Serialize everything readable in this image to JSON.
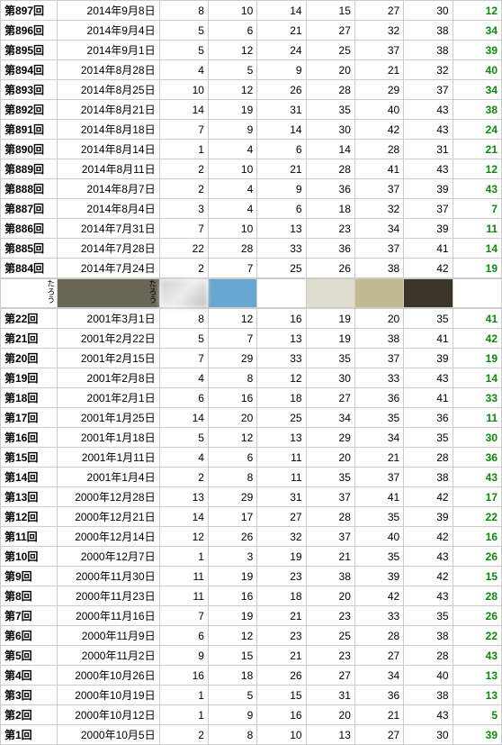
{
  "upper_rows": [
    {
      "label": "第897回",
      "date": "2014年9月8日",
      "n": [
        8,
        10,
        14,
        15,
        27,
        30
      ],
      "g": 12
    },
    {
      "label": "第896回",
      "date": "2014年9月4日",
      "n": [
        5,
        6,
        21,
        27,
        32,
        38
      ],
      "g": 34
    },
    {
      "label": "第895回",
      "date": "2014年9月1日",
      "n": [
        5,
        12,
        24,
        25,
        37,
        38
      ],
      "g": 39
    },
    {
      "label": "第894回",
      "date": "2014年8月28日",
      "n": [
        4,
        5,
        9,
        20,
        21,
        32
      ],
      "g": 40
    },
    {
      "label": "第893回",
      "date": "2014年8月25日",
      "n": [
        10,
        12,
        26,
        28,
        29,
        37
      ],
      "g": 34
    },
    {
      "label": "第892回",
      "date": "2014年8月21日",
      "n": [
        14,
        19,
        31,
        35,
        40,
        43
      ],
      "g": 38
    },
    {
      "label": "第891回",
      "date": "2014年8月18日",
      "n": [
        7,
        9,
        14,
        30,
        42,
        43
      ],
      "g": 24
    },
    {
      "label": "第890回",
      "date": "2014年8月14日",
      "n": [
        1,
        4,
        6,
        14,
        28,
        31
      ],
      "g": 21
    },
    {
      "label": "第889回",
      "date": "2014年8月11日",
      "n": [
        2,
        10,
        21,
        28,
        41,
        43
      ],
      "g": 12
    },
    {
      "label": "第888回",
      "date": "2014年8月7日",
      "n": [
        2,
        4,
        9,
        36,
        37,
        39
      ],
      "g": 43
    },
    {
      "label": "第887回",
      "date": "2014年8月4日",
      "n": [
        3,
        4,
        6,
        18,
        32,
        37
      ],
      "g": 7
    },
    {
      "label": "第886回",
      "date": "2014年7月31日",
      "n": [
        7,
        10,
        13,
        23,
        34,
        39
      ],
      "g": 11
    },
    {
      "label": "第885回",
      "date": "2014年7月28日",
      "n": [
        22,
        28,
        33,
        36,
        37,
        41
      ],
      "g": 14
    },
    {
      "label": "第884回",
      "date": "2014年7月24日",
      "n": [
        2,
        7,
        25,
        26,
        38,
        42
      ],
      "g": 19
    }
  ],
  "swatches": [
    {
      "label": "たろう",
      "color": "#ffffff"
    },
    {
      "label": "たろう",
      "color": "#6b6757"
    },
    {
      "label": "",
      "color": "#ffffff",
      "img": true
    },
    {
      "label": "",
      "color": "#67a7d1"
    },
    {
      "label": "",
      "color": "#ffffff"
    },
    {
      "label": "",
      "color": "#dedccc"
    },
    {
      "label": "",
      "color": "#c1b98f"
    },
    {
      "label": "",
      "color": "#3a3527"
    },
    {
      "label": "",
      "color": "#ffffff"
    }
  ],
  "lower_rows": [
    {
      "label": "第22回",
      "date": "2001年3月1日",
      "n": [
        8,
        12,
        16,
        19,
        20,
        35
      ],
      "g": 41
    },
    {
      "label": "第21回",
      "date": "2001年2月22日",
      "n": [
        5,
        7,
        13,
        19,
        38,
        41
      ],
      "g": 42
    },
    {
      "label": "第20回",
      "date": "2001年2月15日",
      "n": [
        7,
        29,
        33,
        35,
        37,
        39
      ],
      "g": 19
    },
    {
      "label": "第19回",
      "date": "2001年2月8日",
      "n": [
        4,
        8,
        12,
        30,
        33,
        43
      ],
      "g": 14
    },
    {
      "label": "第18回",
      "date": "2001年2月1日",
      "n": [
        6,
        16,
        18,
        27,
        36,
        41
      ],
      "g": 33
    },
    {
      "label": "第17回",
      "date": "2001年1月25日",
      "n": [
        14,
        20,
        25,
        34,
        35,
        36
      ],
      "g": 11
    },
    {
      "label": "第16回",
      "date": "2001年1月18日",
      "n": [
        5,
        12,
        13,
        29,
        34,
        35
      ],
      "g": 30
    },
    {
      "label": "第15回",
      "date": "2001年1月11日",
      "n": [
        4,
        6,
        11,
        20,
        21,
        28
      ],
      "g": 36
    },
    {
      "label": "第14回",
      "date": "2001年1月4日",
      "n": [
        2,
        8,
        11,
        35,
        37,
        38
      ],
      "g": 43
    },
    {
      "label": "第13回",
      "date": "2000年12月28日",
      "n": [
        13,
        29,
        31,
        37,
        41,
        42
      ],
      "g": 17
    },
    {
      "label": "第12回",
      "date": "2000年12月21日",
      "n": [
        14,
        17,
        27,
        28,
        35,
        39
      ],
      "g": 22
    },
    {
      "label": "第11回",
      "date": "2000年12月14日",
      "n": [
        12,
        26,
        32,
        37,
        40,
        42
      ],
      "g": 16
    },
    {
      "label": "第10回",
      "date": "2000年12月7日",
      "n": [
        1,
        3,
        19,
        21,
        35,
        43
      ],
      "g": 26
    },
    {
      "label": "第9回",
      "date": "2000年11月30日",
      "n": [
        11,
        19,
        23,
        38,
        39,
        42
      ],
      "g": 15
    },
    {
      "label": "第8回",
      "date": "2000年11月23日",
      "n": [
        11,
        16,
        18,
        20,
        42,
        43
      ],
      "g": 28
    },
    {
      "label": "第7回",
      "date": "2000年11月16日",
      "n": [
        7,
        19,
        21,
        23,
        33,
        35
      ],
      "g": 26
    },
    {
      "label": "第6回",
      "date": "2000年11月9日",
      "n": [
        6,
        12,
        23,
        25,
        28,
        38
      ],
      "g": 22
    },
    {
      "label": "第5回",
      "date": "2000年11月2日",
      "n": [
        9,
        15,
        21,
        23,
        27,
        28
      ],
      "g": 43
    },
    {
      "label": "第4回",
      "date": "2000年10月26日",
      "n": [
        16,
        18,
        26,
        27,
        34,
        40
      ],
      "g": 13
    },
    {
      "label": "第3回",
      "date": "2000年10月19日",
      "n": [
        1,
        5,
        15,
        31,
        36,
        38
      ],
      "g": 13
    },
    {
      "label": "第2回",
      "date": "2000年10月12日",
      "n": [
        1,
        9,
        16,
        20,
        21,
        43
      ],
      "g": 5
    },
    {
      "label": "第1回",
      "date": "2000年10月5日",
      "n": [
        2,
        8,
        10,
        13,
        27,
        30
      ],
      "g": 39
    }
  ]
}
